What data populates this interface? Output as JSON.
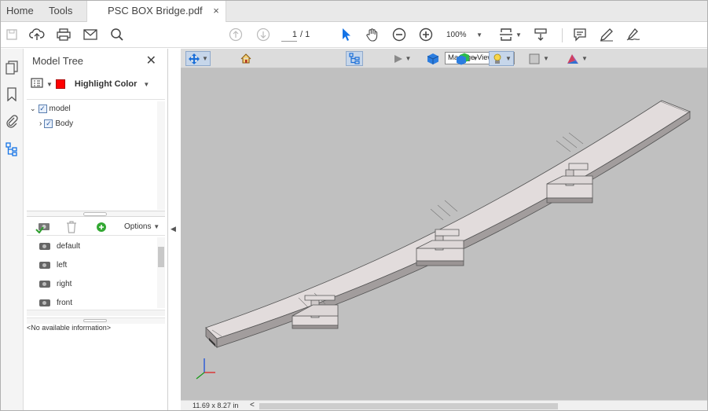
{
  "tabs": [
    {
      "label": "Home"
    },
    {
      "label": "Tools"
    },
    {
      "label": "PSC BOX Bridge.pdf",
      "close": "×"
    }
  ],
  "toolbar": {
    "page_current": "1",
    "page_total": "/ 1",
    "zoom": "100%",
    "icons": [
      "save-icon",
      "upload-icon",
      "print-icon",
      "email-icon",
      "search-icon",
      "page-up-icon",
      "page-down-icon",
      "select-arrow-icon",
      "hand-icon",
      "zoom-out-icon",
      "zoom-in-icon",
      "fit-page-icon",
      "scroll-mode-icon",
      "comment-icon",
      "pen-icon",
      "sign-icon"
    ]
  },
  "left_rail": {
    "icons": [
      "pages-icon",
      "bookmark-icon",
      "attachment-icon",
      "model-tree-icon"
    ]
  },
  "model_tree": {
    "title": "Model Tree",
    "close": "✕",
    "highlight_label": "Highlight Color",
    "highlight_color": "#ff0000",
    "nodes": [
      {
        "label": "model",
        "expanded": true,
        "checked": true
      },
      {
        "label": "Body",
        "expanded": false,
        "checked": true
      }
    ],
    "options_label": "Options",
    "views": [
      "default",
      "left",
      "right",
      "front"
    ],
    "info": "<No available information>"
  },
  "viewer_toolbar": {
    "manage_views": "Manage Views...",
    "icons": [
      "rotate-icon",
      "home-view-icon",
      "model-tree-toggle-icon",
      "play-icon",
      "solid-render-icon",
      "lighting-icon",
      "background-icon",
      "cross-section-icon",
      "color-icon"
    ]
  },
  "status": {
    "page_size": "11.69 x 8.27 in",
    "scroll_left": "<"
  },
  "colors": {
    "viewport_background": "#c0c0c0",
    "bridge_face": "#e2dcdc",
    "bridge_side": "#9a9494",
    "highlight": "#ff0000",
    "accent_blue": "#1473e6"
  }
}
